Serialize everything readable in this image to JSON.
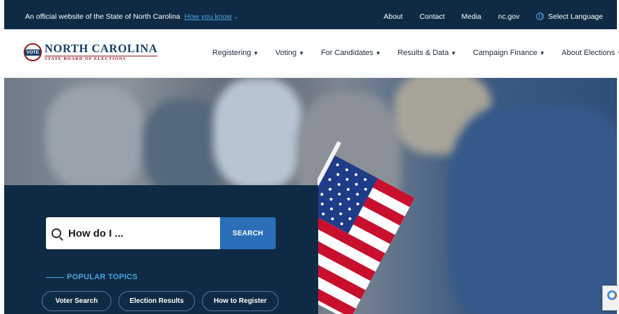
{
  "gov_banner": {
    "official_text": "An official website of the State of North Carolina",
    "how_you_know": "How you know",
    "links": [
      "About",
      "Contact",
      "Media",
      "nc.gov"
    ],
    "language": "Select Language"
  },
  "header": {
    "logo_badge": "VOTE",
    "logo_title": "NORTH CAROLINA",
    "logo_subtitle": "STATE BOARD OF ELECTIONS",
    "nav": [
      "Registering",
      "Voting",
      "For Candidates",
      "Results & Data",
      "Campaign Finance",
      "About Elections"
    ]
  },
  "search": {
    "placeholder": "How do I ...",
    "button": "SEARCH"
  },
  "popular": {
    "heading": "POPULAR TOPICS",
    "topics": [
      "Voter Search",
      "Election Results",
      "How to Register"
    ]
  },
  "colors": {
    "navy": "#0f2a44",
    "accent_blue": "#2a6fb8",
    "link_blue": "#4aa3df",
    "brand_red": "#8b1a1a"
  }
}
